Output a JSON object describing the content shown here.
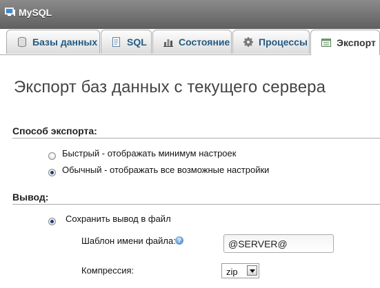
{
  "window": {
    "title": "MySQL",
    "icon": "server-icon"
  },
  "tabs": [
    {
      "label": "Базы данных",
      "icon": "database-icon",
      "active": false
    },
    {
      "label": "SQL",
      "icon": "sql-icon",
      "active": false
    },
    {
      "label": "Состояние",
      "icon": "status-icon",
      "active": false
    },
    {
      "label": "Процессы",
      "icon": "gear-icon",
      "active": false
    },
    {
      "label": "Экспорт",
      "icon": "export-icon",
      "active": true
    }
  ],
  "page": {
    "title": "Экспорт баз данных с текущего сервера"
  },
  "export_method": {
    "heading": "Способ экспорта:",
    "options": [
      {
        "label": "Быстрый - отображать минимум настроек",
        "selected": false
      },
      {
        "label": "Обычный - отображать все возможные настройки",
        "selected": true
      }
    ]
  },
  "output": {
    "heading": "Вывод:",
    "save_to_file": {
      "label": "Сохранить вывод в файл",
      "selected": true
    },
    "filename_template": {
      "label": "Шаблон имени файла:",
      "value": "@SERVER@"
    },
    "compression": {
      "label": "Компрессия:",
      "selected": "zip"
    }
  }
}
